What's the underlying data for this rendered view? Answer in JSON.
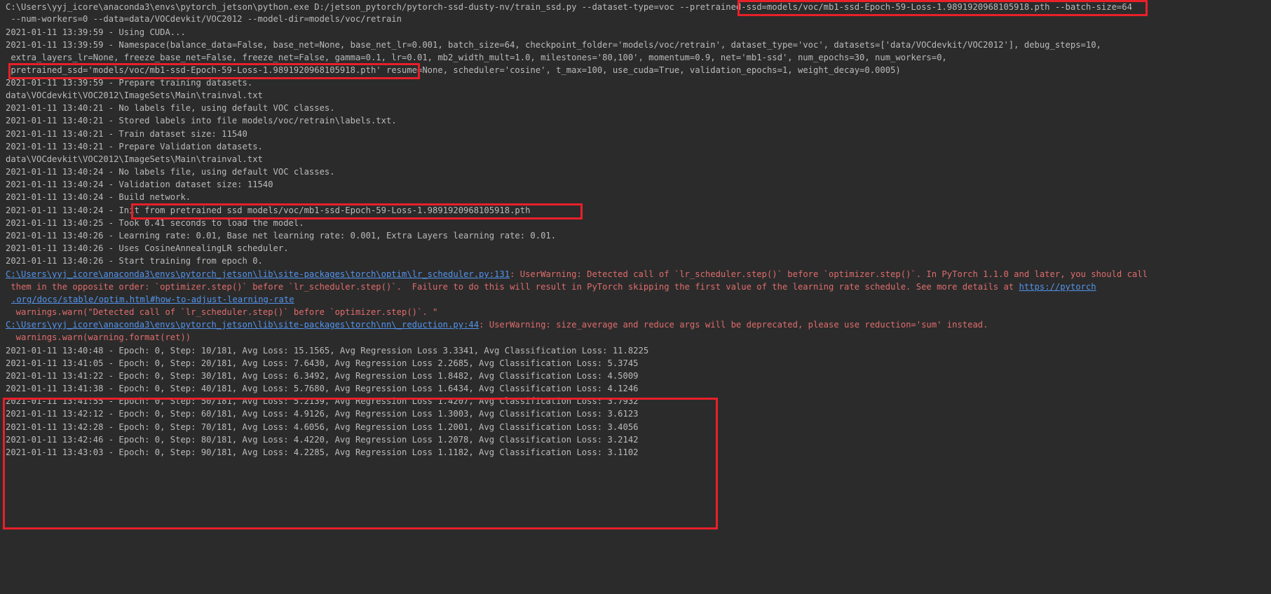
{
  "command": {
    "prefix": "C:\\Users\\yyj_icore\\anaconda3\\envs\\pytorch_jetson\\python.exe D:/jetson_pytorch/pytorch-ssd-dusty-nv/train_ssd.py --dataset-type=voc ",
    "pretrained_arg": "--pretrained-ssd=models/voc/mb1-ssd-Epoch-59-Loss-1.9891920968105918.pth",
    "suffix": " --batch-size=64",
    "line2": " --num-workers=0 --data=data/VOCdevkit/VOC2012 --model-dir=models/voc/retrain"
  },
  "log": {
    "cuda": "2021-01-11 13:39:59 - Using CUDA...",
    "namespace1": "2021-01-11 13:39:59 - Namespace(balance_data=False, base_net=None, base_net_lr=0.001, batch_size=64, checkpoint_folder='models/voc/retrain', dataset_type='voc', datasets=['data/VOCdevkit/VOC2012'], debug_steps=10,",
    "namespace2": " extra_layers_lr=None, freeze_base_net=False, freeze_net=False, gamma=0.1, lr=0.01, mb2_width_mult=1.0, milestones='80,100', momentum=0.9, net='mb1-ssd', num_epochs=30, num_workers=0,",
    "namespace3_boxed": " pretrained_ssd='models/voc/mb1-ssd-Epoch-59-Loss-1.9891920968105918.pth'",
    "namespace3_rest": " resume=None, scheduler='cosine', t_max=100, use_cuda=True, validation_epochs=1, weight_decay=0.0005)",
    "prep_train": "2021-01-11 13:39:59 - Prepare training datasets.",
    "trainval1": "data\\VOCdevkit\\VOC2012\\ImageSets\\Main\\trainval.txt",
    "nolabels1": "2021-01-11 13:40:21 - No labels file, using default VOC classes.",
    "stored": "2021-01-11 13:40:21 - Stored labels into file models/voc/retrain\\labels.txt.",
    "train_size": "2021-01-11 13:40:21 - Train dataset size: 11540",
    "prep_val": "2021-01-11 13:40:21 - Prepare Validation datasets.",
    "trainval2": "data\\VOCdevkit\\VOC2012\\ImageSets\\Main\\trainval.txt",
    "nolabels2": "2021-01-11 13:40:24 - No labels file, using default VOC classes.",
    "val_size": "2021-01-11 13:40:24 - Validation dataset size: 11540",
    "build": "2021-01-11 13:40:24 - Build network.",
    "init_prefix": "2021-01-11 13:40:24 - ",
    "init_boxed": "Init from pretrained ssd models/voc/mb1-ssd-Epoch-59-Loss-1.9891920968105918.pth",
    "took": "2021-01-11 13:40:25 - Took 0.41 seconds to load the model.",
    "lr": "2021-01-11 13:40:26 - Learning rate: 0.01, Base net learning rate: 0.001, Extra Layers learning rate: 0.01.",
    "sched": "2021-01-11 13:40:26 - Uses CosineAnnealingLR scheduler.",
    "start": "2021-01-11 13:40:26 - Start training from epoch 0."
  },
  "warnings": {
    "w1_link": "C:\\Users\\yyj_icore\\anaconda3\\envs\\pytorch_jetson\\lib\\site-packages\\torch\\optim\\lr_scheduler.py:131",
    "w1_text": ": UserWarning: Detected call of `lr_scheduler.step()` before `optimizer.step()`. In PyTorch 1.1.0 and later, you should call",
    "w1_line2": " them in the opposite order: `optimizer.step()` before `lr_scheduler.step()`.  Failure to do this will result in PyTorch skipping the first value of the learning rate schedule. See more details at ",
    "w1_url1": "https://pytorch",
    "w1_url2": ".org/docs/stable/optim.html#how-to-adjust-learning-rate",
    "w1_warn": "  warnings.warn(\"Detected call of `lr_scheduler.step()` before `optimizer.step()`. \"",
    "w2_link": "C:\\Users\\yyj_icore\\anaconda3\\envs\\pytorch_jetson\\lib\\site-packages\\torch\\nn\\_reduction.py:44",
    "w2_text": ": UserWarning: size_average and reduce args will be deprecated, please use reduction='sum' instead.",
    "w2_warn": "  warnings.warn(warning.format(ret))"
  },
  "epochs": [
    "2021-01-11 13:40:48 - Epoch: 0, Step: 10/181, Avg Loss: 15.1565, Avg Regression Loss 3.3341, Avg Classification Loss: 11.8225",
    "2021-01-11 13:41:05 - Epoch: 0, Step: 20/181, Avg Loss: 7.6430, Avg Regression Loss 2.2685, Avg Classification Loss: 5.3745",
    "2021-01-11 13:41:22 - Epoch: 0, Step: 30/181, Avg Loss: 6.3492, Avg Regression Loss 1.8482, Avg Classification Loss: 4.5009",
    "2021-01-11 13:41:38 - Epoch: 0, Step: 40/181, Avg Loss: 5.7680, Avg Regression Loss 1.6434, Avg Classification Loss: 4.1246",
    "2021-01-11 13:41:55 - Epoch: 0, Step: 50/181, Avg Loss: 5.2139, Avg Regression Loss 1.4207, Avg Classification Loss: 3.7932",
    "2021-01-11 13:42:12 - Epoch: 0, Step: 60/181, Avg Loss: 4.9126, Avg Regression Loss 1.3003, Avg Classification Loss: 3.6123",
    "2021-01-11 13:42:28 - Epoch: 0, Step: 70/181, Avg Loss: 4.6056, Avg Regression Loss 1.2001, Avg Classification Loss: 3.4056",
    "2021-01-11 13:42:46 - Epoch: 0, Step: 80/181, Avg Loss: 4.4220, Avg Regression Loss 1.2078, Avg Classification Loss: 3.2142",
    "2021-01-11 13:43:03 - Epoch: 0, Step: 90/181, Avg Loss: 4.2285, Avg Regression Loss 1.1182, Avg Classification Loss: 3.1102"
  ],
  "colors": {
    "background": "#2b2b2b",
    "text": "#bbbbbb",
    "error": "#e06c6c",
    "link": "#5394ec",
    "highlight": "#e8202a"
  }
}
